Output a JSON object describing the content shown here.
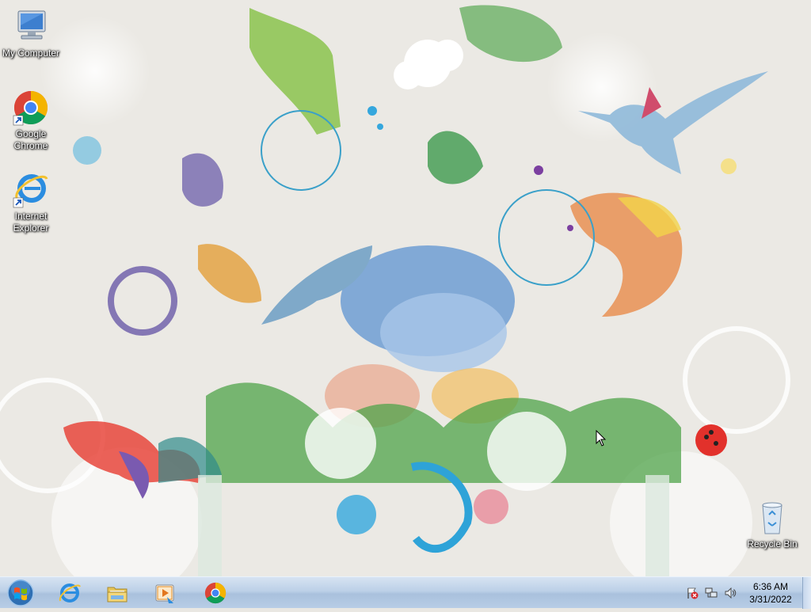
{
  "desktop": {
    "icons": [
      {
        "label": "My Computer",
        "icon": "computer-icon"
      },
      {
        "label": "Google Chrome",
        "icon": "chrome-icon"
      },
      {
        "label": "Internet Explorer",
        "icon": "internet-explorer-icon"
      },
      {
        "label": "Recycle Bin",
        "icon": "recycle-bin-icon"
      }
    ]
  },
  "taskbar": {
    "start": {
      "icon": "windows-orb-icon"
    },
    "pinned": [
      {
        "icon": "internet-explorer-icon"
      },
      {
        "icon": "file-explorer-icon"
      },
      {
        "icon": "media-player-icon"
      },
      {
        "icon": "chrome-icon"
      }
    ],
    "tray": {
      "icons": [
        "action-center-flag-icon",
        "network-icon",
        "volume-icon"
      ],
      "time": "6:36 AM",
      "date": "3/31/2022"
    }
  },
  "colors": {
    "taskbar": "#bcd0e7",
    "wallpaper_bg": "#ebe9e4"
  }
}
